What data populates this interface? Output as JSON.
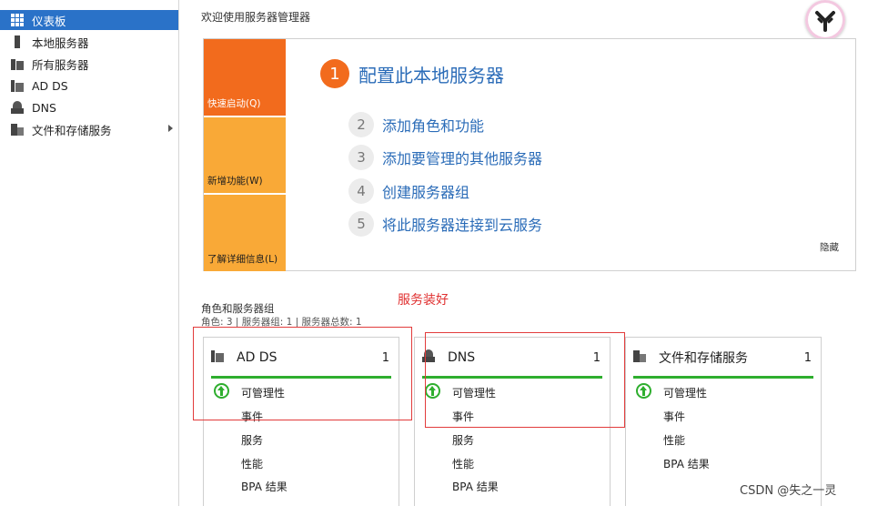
{
  "sidebar": {
    "items": [
      {
        "label": "仪表板",
        "icon": "dashboard-icon",
        "active": true
      },
      {
        "label": "本地服务器",
        "icon": "server-icon"
      },
      {
        "label": "所有服务器",
        "icon": "servers-icon"
      },
      {
        "label": "AD DS",
        "icon": "ad-ds-icon"
      },
      {
        "label": "DNS",
        "icon": "dns-icon"
      },
      {
        "label": "文件和存储服务",
        "icon": "file-storage-icon",
        "has_submenu": true
      }
    ]
  },
  "header": {
    "title": "欢迎使用服务器管理器"
  },
  "quickstart": {
    "tiles": [
      "快速启动(Q)",
      "新增功能(W)",
      "了解详细信息(L)"
    ],
    "main_step": {
      "num": "1",
      "label": "配置此本地服务器"
    },
    "steps": [
      {
        "num": "2",
        "label": "添加角色和功能"
      },
      {
        "num": "3",
        "label": "添加要管理的其他服务器"
      },
      {
        "num": "4",
        "label": "创建服务器组"
      },
      {
        "num": "5",
        "label": "将此服务器连接到云服务"
      }
    ],
    "hide_label": "隐藏"
  },
  "roles": {
    "title": "角色和服务器组",
    "summary": "角色: 3 | 服务器组: 1 | 服务器总数: 1",
    "annotation": "服务装好",
    "cards": [
      {
        "name": "AD DS",
        "count": "1",
        "icon": "ad-ds-icon",
        "rows": [
          "可管理性",
          "事件",
          "服务",
          "性能",
          "BPA 结果"
        ]
      },
      {
        "name": "DNS",
        "count": "1",
        "icon": "dns-icon",
        "rows": [
          "可管理性",
          "事件",
          "服务",
          "性能",
          "BPA 结果"
        ]
      },
      {
        "name": "文件和存储服务",
        "count": "1",
        "icon": "file-storage-icon",
        "rows": [
          "可管理性",
          "事件",
          "性能",
          "BPA 结果"
        ]
      }
    ]
  },
  "watermark": "CSDN @失之一灵",
  "colors": {
    "accent": "#2a72c8",
    "orange": "#f26b1d",
    "amber": "#f9a937",
    "link": "#2b6cb8",
    "status_ok": "#2eae2e",
    "annotation_red": "#e03030"
  }
}
